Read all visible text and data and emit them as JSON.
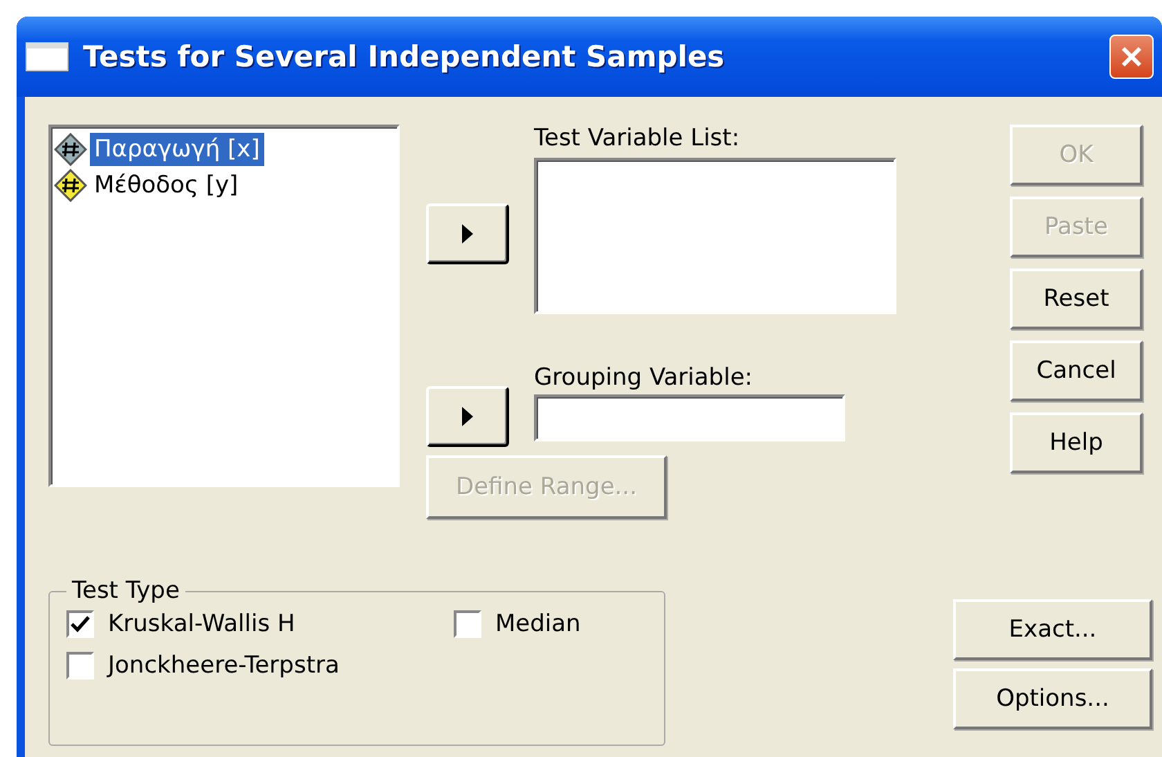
{
  "window": {
    "title": "Tests for Several Independent Samples"
  },
  "variables": [
    {
      "label": "Παραγωγή [x]",
      "kind": "scale",
      "selected": true
    },
    {
      "label": "Μέθοδος [y]",
      "kind": "nominal",
      "selected": false
    }
  ],
  "test_variable_list": {
    "label": "Test Variable List:"
  },
  "grouping_variable": {
    "label": "Grouping Variable:",
    "define_range": {
      "label": "Define Range...",
      "disabled": true
    }
  },
  "buttons": [
    {
      "label": "OK",
      "disabled": true
    },
    {
      "label": "Paste",
      "disabled": true
    },
    {
      "label": "Reset",
      "disabled": false
    },
    {
      "label": "Cancel",
      "disabled": false
    },
    {
      "label": "Help",
      "disabled": false
    }
  ],
  "test_type": {
    "title": "Test Type",
    "options": [
      {
        "label": "Kruskal-Wallis H",
        "checked": true
      },
      {
        "label": "Median",
        "checked": false
      },
      {
        "label": "Jonckheere-Terpstra",
        "checked": false
      }
    ]
  },
  "extra_buttons": [
    {
      "label": "Exact...",
      "disabled": false
    },
    {
      "label": "Options...",
      "disabled": false
    }
  ]
}
